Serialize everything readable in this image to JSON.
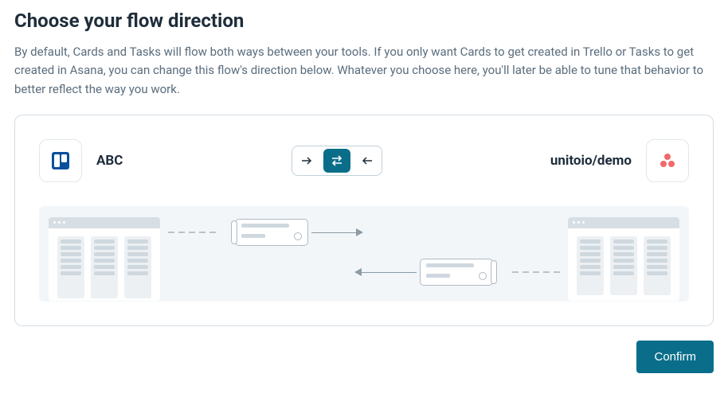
{
  "heading": "Choose your flow direction",
  "description": "By default, Cards and Tasks will flow both ways between your tools. If you only want Cards to get created in Trello or Tasks to get created in Asana, you can change this flow's direction below. Whatever you choose here, you'll later be able to tune that behavior to better reflect the way you work.",
  "left_tool": {
    "label": "ABC",
    "icon": "trello-icon",
    "icon_color": "#0a4f9c"
  },
  "right_tool": {
    "label": "unitoio/demo",
    "icon": "asana-icon",
    "icon_color": "#f06a6a"
  },
  "direction_options": [
    {
      "id": "right",
      "icon": "arrow-right-icon",
      "selected": false
    },
    {
      "id": "both",
      "icon": "arrow-swap-icon",
      "selected": true
    },
    {
      "id": "left",
      "icon": "arrow-left-icon",
      "selected": false
    }
  ],
  "confirm_label": "Confirm"
}
